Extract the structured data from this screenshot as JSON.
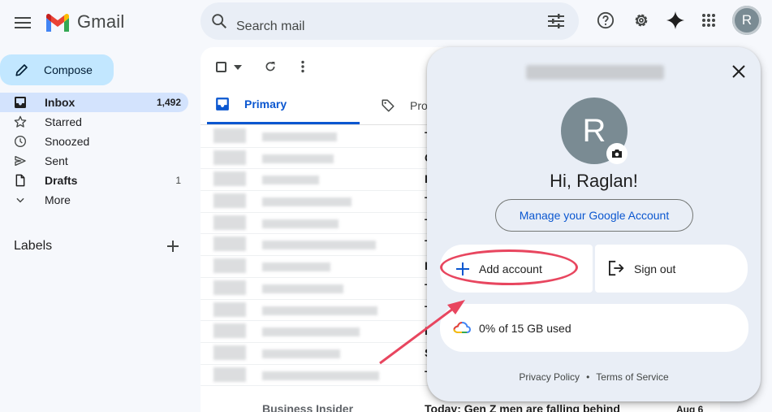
{
  "app": {
    "name": "Gmail"
  },
  "search": {
    "placeholder": "Search mail"
  },
  "account": {
    "initial": "R",
    "greeting": "Hi, Raglan!"
  },
  "sidebar": {
    "compose_label": "Compose",
    "items": [
      {
        "label": "Inbox",
        "count": "1,492",
        "icon": "inbox-icon"
      },
      {
        "label": "Starred",
        "count": "",
        "icon": "star-icon"
      },
      {
        "label": "Snoozed",
        "count": "",
        "icon": "clock-icon"
      },
      {
        "label": "Sent",
        "count": "",
        "icon": "send-icon"
      },
      {
        "label": "Drafts",
        "count": "1",
        "icon": "draft-icon"
      },
      {
        "label": "More",
        "count": "",
        "icon": "chevron-down-icon"
      }
    ],
    "labels_heading": "Labels"
  },
  "tabs": [
    {
      "label": "Primary"
    },
    {
      "label": "Pro"
    }
  ],
  "inbox": {
    "row_subject_initials": [
      "T",
      "C",
      "I",
      "T",
      "T",
      "T",
      "I",
      "T",
      "T",
      "I",
      "S",
      "T"
    ],
    "last_row": {
      "sender": "Business Insider",
      "subject": "Today: Gen Z men are falling behind",
      "date": "Aug 6"
    }
  },
  "popup": {
    "manage_label": "Manage your Google Account",
    "add_account_label": "Add account",
    "sign_out_label": "Sign out",
    "storage_label": "0% of 15 GB used",
    "privacy_label": "Privacy Policy",
    "separator": "•",
    "terms_label": "Terms of Service"
  },
  "colors": {
    "accent": "#0b57d0",
    "compose_bg": "#c2e7ff",
    "active_nav": "#d3e3fd",
    "popup_bg": "#e9eef6",
    "avatar": "#7a8b93",
    "annotation": "#e8465f"
  }
}
